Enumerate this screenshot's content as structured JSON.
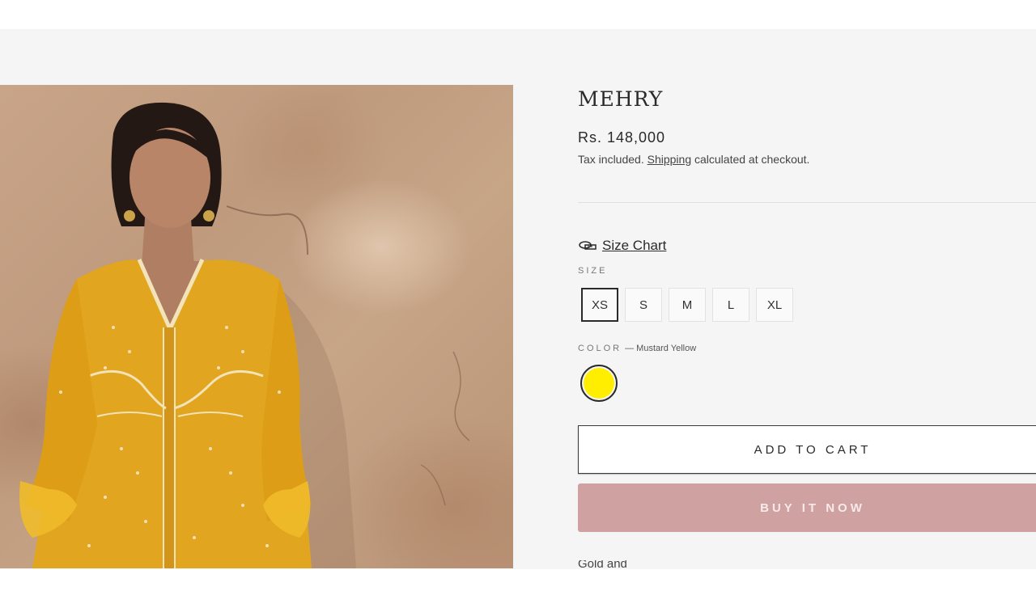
{
  "product": {
    "title": "MEHRY",
    "price": "Rs. 148,000",
    "tax_note_prefix": "Tax included. ",
    "tax_note_link": "Shipping",
    "tax_note_suffix": " calculated at checkout.",
    "size_chart_label": "Size Chart",
    "size_label": "SIZE",
    "sizes": [
      "XS",
      "S",
      "M",
      "L",
      "XL"
    ],
    "selected_size": "XS",
    "color_label": "COLOR",
    "color_value": "— Mustard Yellow",
    "swatch_color": "#ffee00",
    "add_to_cart": "ADD TO CART",
    "buy_now": "BUY IT NOW",
    "description": "Gold and"
  },
  "colors": {
    "accent": "#cfa1a1",
    "page_bg": "#f5f5f5",
    "text": "#2a2a2a"
  },
  "icons": {
    "size_chart": "ruler-icon"
  }
}
